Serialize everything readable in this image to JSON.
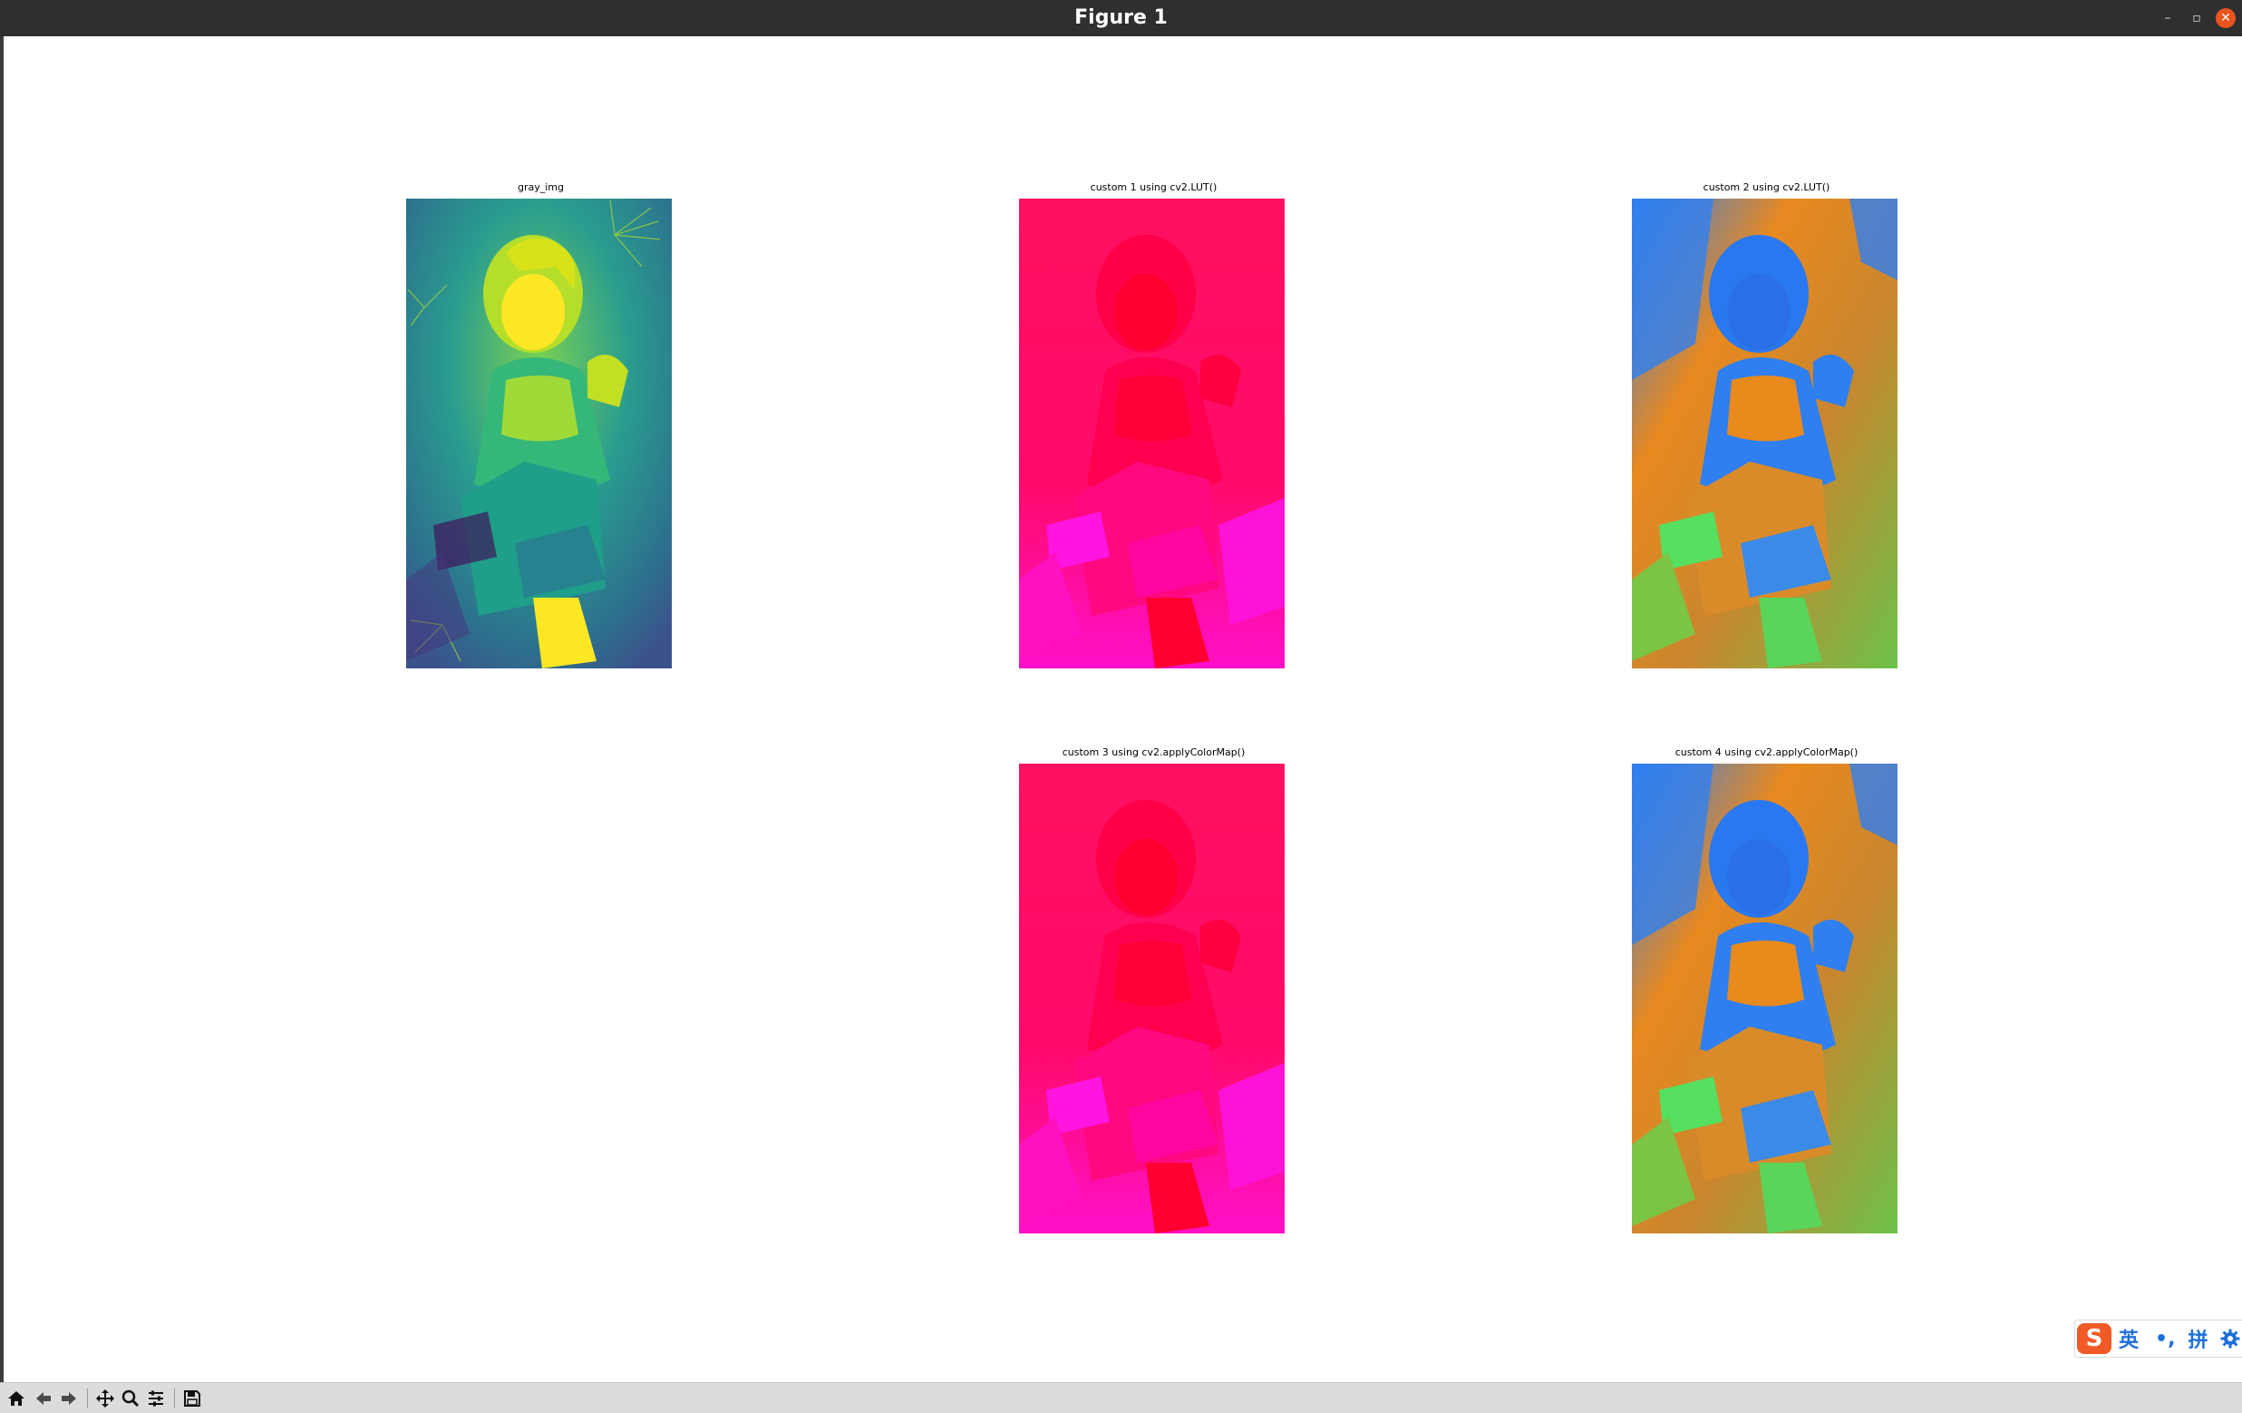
{
  "window": {
    "title": "Figure 1",
    "buttons": [
      "–",
      "▫",
      "✕"
    ]
  },
  "figure": {
    "subplots": [
      {
        "title": "gray_img",
        "colormap": "viridis"
      },
      {
        "title": "custom 1 using cv2.LUT()",
        "colormap": "magenta-red"
      },
      {
        "title": "custom 2 using cv2.LUT()",
        "colormap": "blue-orange-green"
      },
      {
        "title": "custom 3 using cv2.applyColorMap()",
        "colormap": "magenta-red"
      },
      {
        "title": "custom 4 using cv2.applyColorMap()",
        "colormap": "blue-orange-green"
      }
    ]
  },
  "toolbar": {
    "buttons": [
      "home-icon",
      "back-icon",
      "forward-icon",
      "pan-icon",
      "zoom-icon",
      "configure-subplots-icon",
      "save-icon"
    ]
  },
  "ime": {
    "logo": "S",
    "mode_label": "英",
    "punct_label": "•,",
    "input_label": "拼",
    "settings_icon": "gear-icon"
  },
  "colors": {
    "titlebar": "#2f2f2f",
    "close_button": "#e95420",
    "toolbar": "#dcdcdc",
    "ime_accent": "#1e6fd9"
  }
}
